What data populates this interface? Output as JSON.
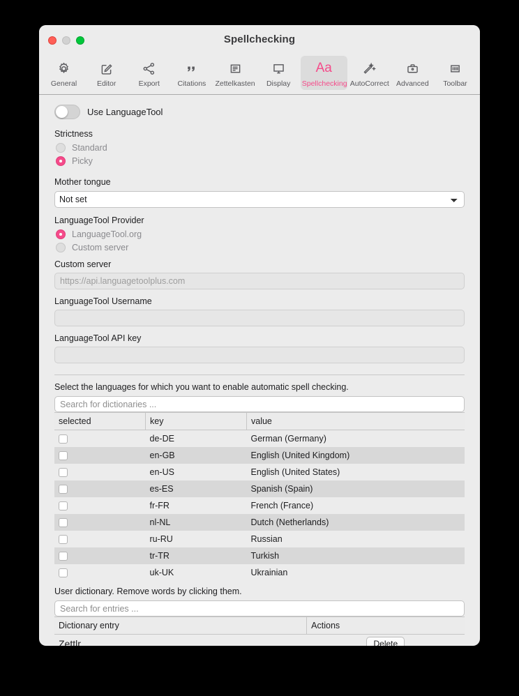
{
  "window": {
    "title": "Spellchecking",
    "traffic_lights": [
      "close",
      "minimize",
      "zoom"
    ]
  },
  "toolbar": {
    "tabs": [
      {
        "label": "General",
        "icon": "gear-icon",
        "active": false
      },
      {
        "label": "Editor",
        "icon": "pencil-square-icon",
        "active": false
      },
      {
        "label": "Export",
        "icon": "share-nodes-icon",
        "active": false
      },
      {
        "label": "Citations",
        "icon": "quote-icon",
        "active": false
      },
      {
        "label": "Zettelkasten",
        "icon": "document-lines-icon",
        "active": false
      },
      {
        "label": "Display",
        "icon": "monitor-icon",
        "active": false
      },
      {
        "label": "Spellchecking",
        "icon": "aa-icon",
        "active": true
      },
      {
        "label": "AutoCorrect",
        "icon": "magic-wand-icon",
        "active": false
      },
      {
        "label": "Advanced",
        "icon": "briefcase-icon",
        "active": false
      },
      {
        "label": "Toolbar",
        "icon": "bars-icon",
        "active": false
      }
    ],
    "accent_color": "#f54b8a"
  },
  "settings": {
    "use_languagetool": {
      "label": "Use LanguageTool",
      "enabled": false
    },
    "strictness": {
      "label": "Strictness",
      "options": [
        {
          "label": "Standard",
          "selected": false
        },
        {
          "label": "Picky",
          "selected": true
        }
      ]
    },
    "mother_tongue": {
      "label": "Mother tongue",
      "value": "Not set",
      "options": [
        "Not set"
      ]
    },
    "provider": {
      "label": "LanguageTool Provider",
      "options": [
        {
          "label": "LanguageTool.org",
          "selected": true
        },
        {
          "label": "Custom server",
          "selected": false
        }
      ]
    },
    "custom_server": {
      "label": "Custom server",
      "value": "",
      "placeholder": "https://api.languagetoolplus.com"
    },
    "username": {
      "label": "LanguageTool Username",
      "value": "",
      "placeholder": ""
    },
    "api_key": {
      "label": "LanguageTool API key",
      "value": "",
      "placeholder": ""
    }
  },
  "dictionaries": {
    "hint": "Select the languages for which you want to enable automatic spell checking.",
    "search_placeholder": "Search for dictionaries ...",
    "search_value": "",
    "columns": [
      "selected",
      "key",
      "value"
    ],
    "rows": [
      {
        "selected": false,
        "key": "de-DE",
        "value": "German (Germany)"
      },
      {
        "selected": false,
        "key": "en-GB",
        "value": "English (United Kingdom)"
      },
      {
        "selected": false,
        "key": "en-US",
        "value": "English (United States)"
      },
      {
        "selected": false,
        "key": "es-ES",
        "value": "Spanish (Spain)"
      },
      {
        "selected": false,
        "key": "fr-FR",
        "value": "French (France)"
      },
      {
        "selected": false,
        "key": "nl-NL",
        "value": "Dutch (Netherlands)"
      },
      {
        "selected": false,
        "key": "ru-RU",
        "value": "Russian"
      },
      {
        "selected": false,
        "key": "tr-TR",
        "value": "Turkish"
      },
      {
        "selected": false,
        "key": "uk-UK",
        "value": "Ukrainian"
      }
    ]
  },
  "user_dictionary": {
    "hint": "User dictionary. Remove words by clicking them.",
    "search_placeholder": "Search for entries ...",
    "search_value": "",
    "columns": [
      "Dictionary entry",
      "Actions"
    ],
    "rows": [
      {
        "entry": "Zettlr",
        "action_label": "Delete"
      }
    ]
  }
}
